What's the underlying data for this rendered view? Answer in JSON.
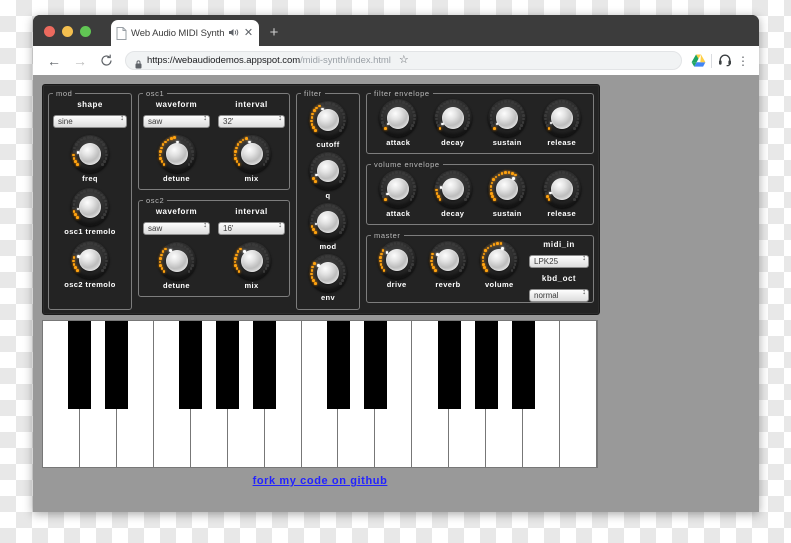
{
  "browser": {
    "tab": {
      "title": "Web Audio MIDI Synthesizer",
      "favicon_icon": "page-icon",
      "audio_icon": "speaker-playing-icon",
      "close_icon": "close-icon"
    },
    "new_tab_icon": "plus-icon",
    "nav": {
      "back_icon": "arrow-left-icon",
      "forward_icon": "arrow-right-icon",
      "reload_icon": "reload-icon"
    },
    "omnibox": {
      "lock_icon": "lock-icon",
      "url_secure": "https://webaudiodemos.appspot.com",
      "url_path": "/midi-synth/index.html",
      "bookmark_icon": "star-icon"
    },
    "toolbar_icons": [
      "drive-icon",
      "profile-icon",
      "kebab-menu-icon"
    ]
  },
  "synth": {
    "mod": {
      "legend": "mod",
      "shape_label": "shape",
      "shape_value": "sine",
      "knobs": [
        {
          "label": "freq",
          "value": 18
        },
        {
          "label": "osc1 tremolo",
          "value": 12
        },
        {
          "label": "osc2 tremolo",
          "value": 22
        }
      ]
    },
    "osc1": {
      "legend": "osc1",
      "waveform_label": "waveform",
      "waveform_value": "saw",
      "interval_label": "interval",
      "interval_value": "32'",
      "knobs": [
        {
          "label": "detune",
          "value": 52
        },
        {
          "label": "mix",
          "value": 46
        }
      ]
    },
    "osc2": {
      "legend": "osc2",
      "waveform_label": "waveform",
      "waveform_value": "saw",
      "interval_label": "interval",
      "interval_value": "16'",
      "knobs": [
        {
          "label": "detune",
          "value": 38
        },
        {
          "label": "mix",
          "value": 36
        }
      ]
    },
    "filter": {
      "legend": "filter",
      "knobs": [
        {
          "label": "cutoff",
          "value": 40
        },
        {
          "label": "q",
          "value": 8
        },
        {
          "label": "mod",
          "value": 12
        },
        {
          "label": "env",
          "value": 30
        }
      ]
    },
    "filter_envelope": {
      "legend": "filter envelope",
      "knobs": [
        {
          "label": "attack",
          "value": 4
        },
        {
          "label": "decay",
          "value": 4
        },
        {
          "label": "sustain",
          "value": 4
        },
        {
          "label": "release",
          "value": 6
        }
      ]
    },
    "volume_envelope": {
      "legend": "volume envelope",
      "knobs": [
        {
          "label": "attack",
          "value": 6
        },
        {
          "label": "decay",
          "value": 18
        },
        {
          "label": "sustain",
          "value": 62
        },
        {
          "label": "release",
          "value": 8
        }
      ]
    },
    "master": {
      "legend": "master",
      "knobs": [
        {
          "label": "drive",
          "value": 30
        },
        {
          "label": "reverb",
          "value": 26
        },
        {
          "label": "volume",
          "value": 56
        }
      ],
      "midi_in_label": "midi_in",
      "midi_in_value": "LPK25",
      "kbd_oct_label": "kbd_oct",
      "kbd_oct_value": "normal"
    }
  },
  "footer": {
    "fork_link": "fork my code on github"
  },
  "colors": {
    "panel_bg": "#232323",
    "page_bg": "#999999",
    "led_on": "#ffa310",
    "link": "#2323ff"
  }
}
